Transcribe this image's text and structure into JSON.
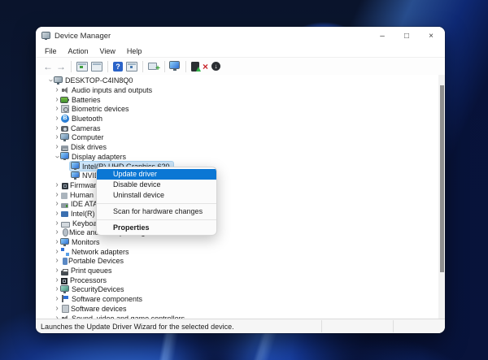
{
  "wallpaper": {
    "style": "windows-11-bloom",
    "base_color": "#0c1a38",
    "accent_color": "#4086f4"
  },
  "window": {
    "title": "Device Manager",
    "controls": [
      {
        "name": "minimize",
        "glyph": "–"
      },
      {
        "name": "maximize",
        "glyph": "□"
      },
      {
        "name": "close",
        "glyph": "×"
      }
    ]
  },
  "menu_bar": {
    "items": [
      "File",
      "Action",
      "View",
      "Help"
    ]
  },
  "toolbar": {
    "items": [
      {
        "name": "back-icon",
        "kind": "glyph",
        "glyph": "←"
      },
      {
        "name": "forward-icon",
        "kind": "glyph",
        "glyph": "→"
      },
      {
        "name": "separator",
        "kind": "sep"
      },
      {
        "name": "console-tree-icon",
        "kind": "win"
      },
      {
        "name": "properties-icon",
        "kind": "win2"
      },
      {
        "name": "separator",
        "kind": "sep"
      },
      {
        "name": "help-icon",
        "kind": "help",
        "glyph": "?"
      },
      {
        "name": "action-pane-icon",
        "kind": "win3"
      },
      {
        "name": "separator",
        "kind": "sep"
      },
      {
        "name": "scan-hardware-changes-icon",
        "kind": "scan"
      },
      {
        "name": "separator",
        "kind": "sep"
      },
      {
        "name": "computer-monitor-icon",
        "kind": "mon"
      },
      {
        "name": "separator",
        "kind": "sep"
      },
      {
        "name": "update-driver-icon",
        "kind": "upd"
      },
      {
        "name": "uninstall-device-icon",
        "kind": "unin",
        "glyph": "×"
      },
      {
        "name": "disable-device-icon",
        "kind": "dis",
        "glyph": "↓"
      }
    ]
  },
  "tree": {
    "items": [
      {
        "label": "DESKTOP-C4IN8Q0",
        "level": 0,
        "chevron": "expanded",
        "icon": "computer-root",
        "selected": false
      },
      {
        "label": "Audio inputs and outputs",
        "level": 1,
        "chevron": "collapsed",
        "icon": "audio",
        "selected": false
      },
      {
        "label": "Batteries",
        "level": 1,
        "chevron": "collapsed",
        "icon": "battery",
        "selected": false
      },
      {
        "label": "Biometric devices",
        "level": 1,
        "chevron": "collapsed",
        "icon": "biometric",
        "selected": false
      },
      {
        "label": "Bluetooth",
        "level": 1,
        "chevron": "collapsed",
        "icon": "bluetooth",
        "selected": false
      },
      {
        "label": "Cameras",
        "level": 1,
        "chevron": "collapsed",
        "icon": "camera",
        "selected": false
      },
      {
        "label": "Computer",
        "level": 1,
        "chevron": "collapsed",
        "icon": "computer",
        "selected": false
      },
      {
        "label": "Disk drives",
        "level": 1,
        "chevron": "collapsed",
        "icon": "disk",
        "selected": false
      },
      {
        "label": "Display adapters",
        "level": 1,
        "chevron": "expanded",
        "icon": "display",
        "selected": false
      },
      {
        "label": "Intel(R) UHD Graphics 620",
        "level": 2,
        "chevron": null,
        "icon": "display",
        "selected": true
      },
      {
        "label": "NVIDIA",
        "level": 2,
        "chevron": null,
        "icon": "display",
        "selected": false
      },
      {
        "label": "Firmware",
        "level": 1,
        "chevron": "collapsed",
        "icon": "firmware",
        "selected": false
      },
      {
        "label": "Human Interface Devices",
        "level": 1,
        "chevron": "collapsed",
        "icon": "hid",
        "selected": false
      },
      {
        "label": "IDE ATA/ATAPI controllers",
        "level": 1,
        "chevron": "collapsed",
        "icon": "ide",
        "selected": false
      },
      {
        "label": "Intel(R)",
        "level": 1,
        "chevron": "collapsed",
        "icon": "intel",
        "selected": false
      },
      {
        "label": "Keyboards",
        "level": 1,
        "chevron": "collapsed",
        "icon": "keyboard",
        "selected": false
      },
      {
        "label": "Mice and other pointing devices",
        "level": 1,
        "chevron": "collapsed",
        "icon": "mouse",
        "selected": false
      },
      {
        "label": "Monitors",
        "level": 1,
        "chevron": "collapsed",
        "icon": "monitor",
        "selected": false
      },
      {
        "label": "Network adapters",
        "level": 1,
        "chevron": "collapsed",
        "icon": "network",
        "selected": false
      },
      {
        "label": "Portable Devices",
        "level": 1,
        "chevron": "collapsed",
        "icon": "portable",
        "selected": false
      },
      {
        "label": "Print queues",
        "level": 1,
        "chevron": "collapsed",
        "icon": "printer",
        "selected": false
      },
      {
        "label": "Processors",
        "level": 1,
        "chevron": "collapsed",
        "icon": "processor",
        "selected": false
      },
      {
        "label": "SecurityDevices",
        "level": 1,
        "chevron": "collapsed",
        "icon": "security",
        "selected": false
      },
      {
        "label": "Software components",
        "level": 1,
        "chevron": "collapsed",
        "icon": "software-component",
        "selected": false
      },
      {
        "label": "Software devices",
        "level": 1,
        "chevron": "collapsed",
        "icon": "software-device",
        "selected": false
      },
      {
        "label": "Sound, video and game controllers",
        "level": 1,
        "chevron": "collapsed",
        "icon": "sound",
        "selected": false
      }
    ]
  },
  "context_menu": {
    "highlight_color": "#0b77d4",
    "items": [
      {
        "label": "Update driver",
        "highlighted": true
      },
      {
        "label": "Disable device"
      },
      {
        "label": "Uninstall device"
      },
      {
        "type": "separator"
      },
      {
        "label": "Scan for hardware changes"
      },
      {
        "type": "separator"
      },
      {
        "label": "Properties",
        "bold": true
      }
    ]
  },
  "status_bar": {
    "text": "Launches the Update Driver Wizard for the selected device."
  },
  "colors": {
    "selection_bg": "#cbe4f8",
    "menu_highlight": "#0b77d4",
    "titlebar_bg": "#ffffff"
  }
}
